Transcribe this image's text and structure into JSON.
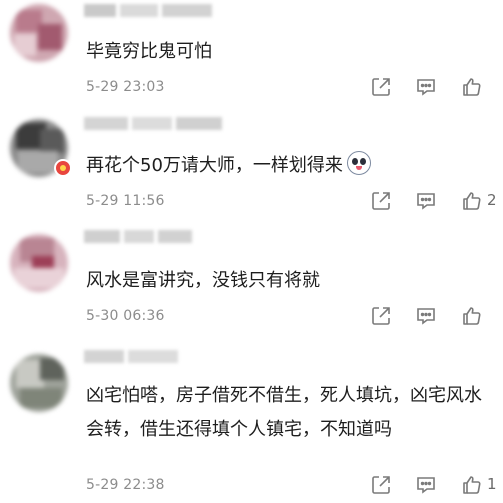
{
  "comments": [
    {
      "content": "毕竟穷比鬼可怕",
      "timestamp": "5-29 23:03",
      "like_count": ""
    },
    {
      "content": "再花个50万请大师，一样划得来",
      "timestamp": "5-29 11:56",
      "like_count": "2",
      "verified_badge": true,
      "emoji": "husky-dog-emoji"
    },
    {
      "content": "风水是富讲究，没钱只有将就",
      "timestamp": "5-30 06:36",
      "like_count": ""
    },
    {
      "content": "凶宅怕嗒，房子借死不借生，死人填坑，凶宅风水会转，借生还得填个人镇宅，不知道吗",
      "timestamp": "5-29 22:38",
      "like_count": "1"
    }
  ],
  "icons": {
    "share": "share-icon",
    "reply": "comment-icon",
    "like": "thumbs-up-icon"
  },
  "colors": {
    "text": "#1e1e1e",
    "meta": "#8c8c8c",
    "icon": "#7a7a7a"
  }
}
